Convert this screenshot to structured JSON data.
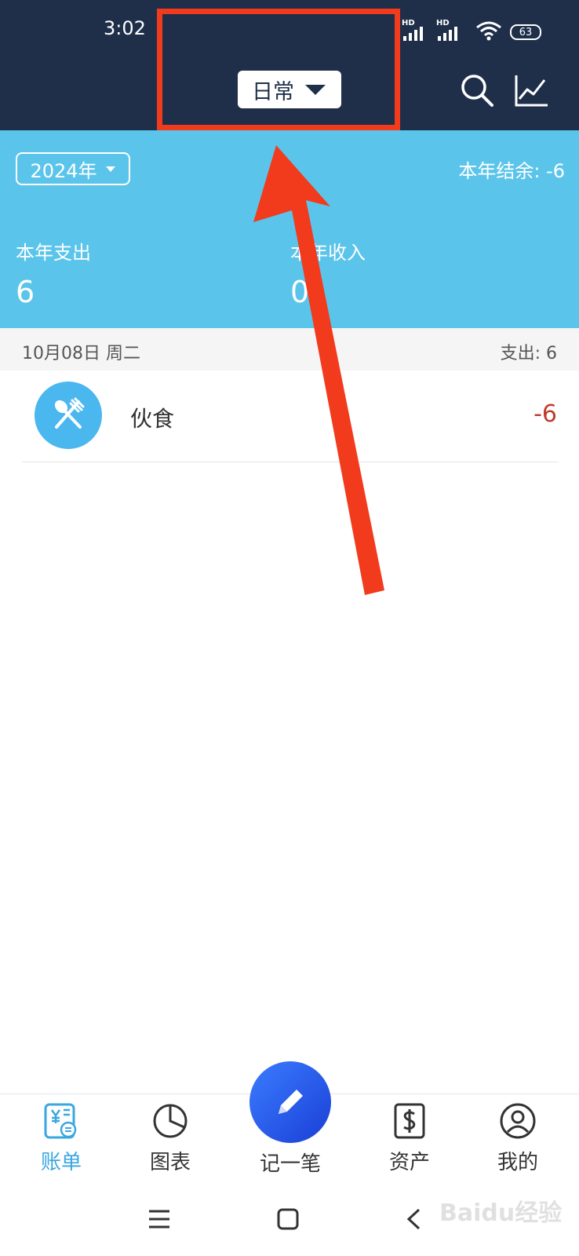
{
  "status_bar": {
    "time": "3:02",
    "signal1_label": "HD",
    "signal2_label": "HD",
    "battery": "63"
  },
  "header": {
    "book_name": "日常"
  },
  "summary": {
    "year": "2024年",
    "balance_label": "本年结余: -6",
    "expense_label": "本年支出",
    "expense_value": "6",
    "income_label": "本年收入",
    "income_value": "0"
  },
  "day_group": {
    "date": "10月08日  周二",
    "total": "支出: 6"
  },
  "records": [
    {
      "name": "伙食",
      "amount": "-6",
      "icon": "fork-spoon-icon"
    }
  ],
  "nav": {
    "items": [
      {
        "label": "账单",
        "icon": "bill-icon",
        "active": true
      },
      {
        "label": "图表",
        "icon": "pie-chart-icon",
        "active": false
      },
      {
        "label": "记一笔",
        "icon": "pencil-icon",
        "active": false
      },
      {
        "label": "资产",
        "icon": "dollar-icon",
        "active": false
      },
      {
        "label": "我的",
        "icon": "profile-icon",
        "active": false
      }
    ]
  },
  "watermark": "Baidu经验",
  "colors": {
    "header_bg": "#1f2f4a",
    "summary_bg": "#5bc4ea",
    "accent": "#3aa7e0",
    "negative": "#c0392b",
    "annotation": "#f23a1c"
  }
}
